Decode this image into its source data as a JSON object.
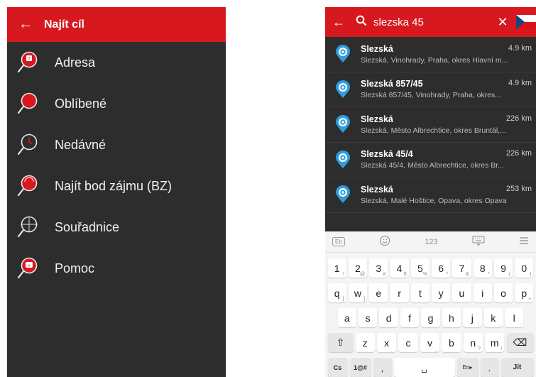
{
  "left": {
    "back_icon": "arrow-left-icon",
    "title": "Najít cíl",
    "items": [
      {
        "label": "Adresa",
        "icon": "address-search-icon"
      },
      {
        "label": "Oblíbené",
        "icon": "favorite-search-icon"
      },
      {
        "label": "Nedávné",
        "icon": "recent-search-icon"
      },
      {
        "label": "Najít bod zájmu (BZ)",
        "icon": "poi-search-icon"
      },
      {
        "label": "Souřadnice",
        "icon": "coordinates-icon"
      },
      {
        "label": "Pomoc",
        "icon": "help-search-icon"
      }
    ]
  },
  "right": {
    "search_query": "slezska 45",
    "results": [
      {
        "name": "Slezská",
        "distance": "4.9 km",
        "address": "Slezská, Vinohrady, Praha, okres Hlavní m..."
      },
      {
        "name": "Slezská 857/45",
        "distance": "4.9 km",
        "address": "Slezská 857/45, Vinohrady, Praha, okres..."
      },
      {
        "name": "Slezská",
        "distance": "226 km",
        "address": "Slezská, Město Albrechtice, okres Bruntál,..."
      },
      {
        "name": "Slezská 45/4",
        "distance": "226 km",
        "address": "Slezská 45/4, Město Albrechtice, okres Br..."
      },
      {
        "name": "Slezská",
        "distance": "253 km",
        "address": "Slezská, Malé Hoštice, Opava, okres Opava"
      }
    ],
    "keyboard": {
      "lang": "En",
      "numbers_label": "123",
      "row_numbers": [
        {
          "k": "1",
          "s": "!"
        },
        {
          "k": "2",
          "s": "@"
        },
        {
          "k": "3",
          "s": "#"
        },
        {
          "k": "4",
          "s": "$"
        },
        {
          "k": "5",
          "s": "%"
        },
        {
          "k": "6",
          "s": "^"
        },
        {
          "k": "7",
          "s": "&"
        },
        {
          "k": "8",
          "s": "*"
        },
        {
          "k": "9",
          "s": "("
        },
        {
          "k": "0",
          "s": ")"
        }
      ],
      "row_q": [
        {
          "k": "q",
          "s": "["
        },
        {
          "k": "w",
          "s": "]"
        },
        {
          "k": "e",
          "s": ""
        },
        {
          "k": "r",
          "s": ""
        },
        {
          "k": "t",
          "s": ""
        },
        {
          "k": "y",
          "s": ""
        },
        {
          "k": "u",
          "s": ""
        },
        {
          "k": "i",
          "s": ""
        },
        {
          "k": "o",
          "s": ""
        },
        {
          "k": "p",
          "s": "+"
        }
      ],
      "row_a": [
        {
          "k": "a",
          "s": ""
        },
        {
          "k": "s",
          "s": ""
        },
        {
          "k": "d",
          "s": ""
        },
        {
          "k": "f",
          "s": ""
        },
        {
          "k": "g",
          "s": ""
        },
        {
          "k": "h",
          "s": ""
        },
        {
          "k": "j",
          "s": ";"
        },
        {
          "k": "k",
          "s": ","
        },
        {
          "k": "l",
          "s": "."
        }
      ],
      "row_z": [
        {
          "k": "z",
          "s": ""
        },
        {
          "k": "x",
          "s": ""
        },
        {
          "k": "c",
          "s": ""
        },
        {
          "k": "v",
          "s": "_"
        },
        {
          "k": "b",
          "s": ""
        },
        {
          "k": "n",
          "s": "?"
        },
        {
          "k": "m",
          "s": "/"
        }
      ],
      "bottom": {
        "cs": "Cs",
        "sym": "1@#",
        "comma": ",",
        "lang_switch": "En▸",
        "period": ".",
        "go": "Jít"
      }
    }
  }
}
